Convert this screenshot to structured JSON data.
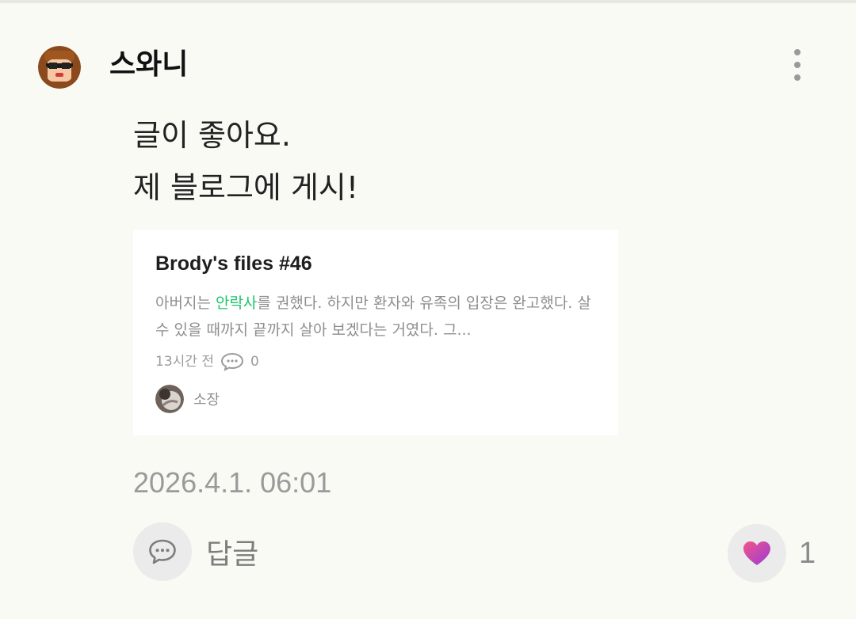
{
  "comment": {
    "author": "스와니",
    "lines": [
      "글이 좋아요.",
      "제 블로그에 게시!"
    ],
    "timestamp": "2026.4.1. 06:01"
  },
  "link_card": {
    "title": "Brody's files #46",
    "excerpt_before": "아버지는 ",
    "excerpt_highlight": "안락사",
    "excerpt_after": "를 권했다. 하지만 환자와 유족의 입장은 완고했다. 살 수 있을 때까지 끝까지 살아 보겠다는 거였다. 그...",
    "time_ago": "13시간 전",
    "comment_count": "0",
    "author": "소장"
  },
  "actions": {
    "reply_label": "답글",
    "like_count": "1"
  },
  "icons": {
    "more": "more-vertical-icon",
    "reply": "speech-bubble-icon",
    "like": "heart-icon"
  },
  "colors": {
    "background": "#f8faf3",
    "highlight": "#1ec46a",
    "heart_start": "#f0568a",
    "heart_end": "#9b3bd6"
  }
}
